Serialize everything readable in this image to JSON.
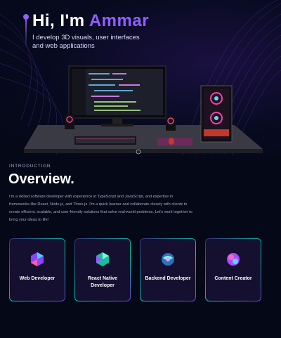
{
  "hero": {
    "greeting": "Hi, I'm ",
    "name": "Ammar",
    "subtitle": "I develop 3D visuals, user interfaces and web applications",
    "accent_color": "#915eff"
  },
  "overview": {
    "label": "INTRODUCTION",
    "title": "Overview.",
    "text": "I'm a skilled software developer with experience in TypeScript and JavaScript, and expertise in frameworks like React, Node.js, and Three.js. I'm a quick learner and collaborate closely with clients to create efficient, scalable, and user-friendly solutions that solve real-world problems. Let's work together to bring your ideas to life!"
  },
  "services": [
    {
      "title": "Web Developer",
      "icon": "web-developer-icon"
    },
    {
      "title": "React Native Developer",
      "icon": "mobile-developer-icon"
    },
    {
      "title": "Backend Developer",
      "icon": "backend-icon"
    },
    {
      "title": "Content Creator",
      "icon": "creator-icon"
    }
  ]
}
